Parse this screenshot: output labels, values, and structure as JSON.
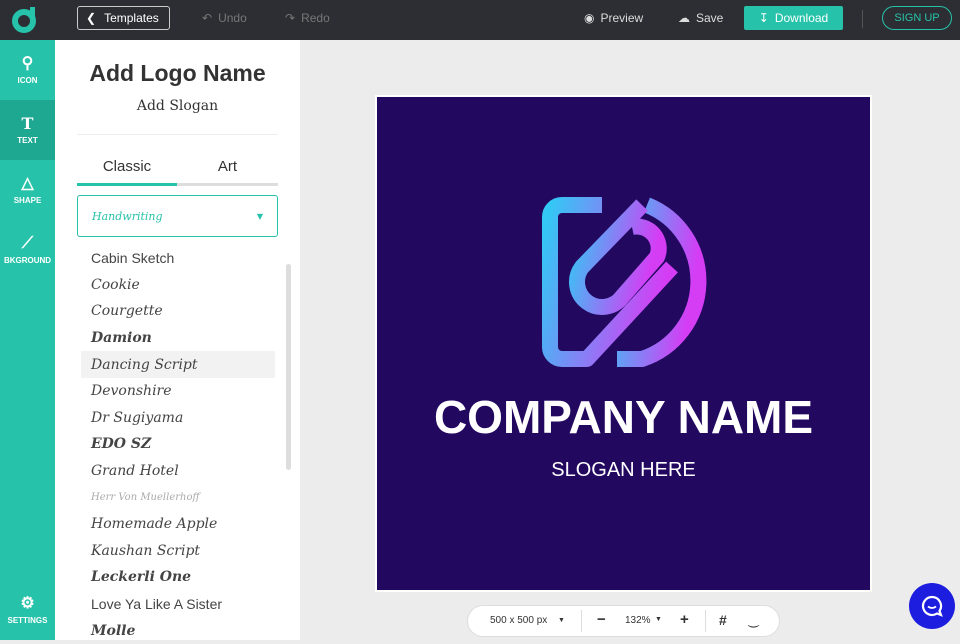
{
  "topbar": {
    "templates": "Templates",
    "undo": "Undo",
    "redo": "Redo",
    "preview": "Preview",
    "save": "Save",
    "download": "Download",
    "signup": "SIGN UP"
  },
  "rail": {
    "icon": "ICON",
    "text": "TEXT",
    "shape": "SHAPE",
    "background": "BKGROUND",
    "settings": "SETTINGS"
  },
  "panel": {
    "title": "Add Logo Name",
    "slogan": "Add Slogan",
    "tabs": [
      "Classic",
      "Art"
    ],
    "category": "Handwriting",
    "fonts": [
      "Cabin Sketch",
      "Cookie",
      "Courgette",
      "Damion",
      "Dancing Script",
      "Devonshire",
      "Dr Sugiyama",
      "EDO SZ",
      "Grand Hotel",
      "Herr Von Muellerhoff",
      "Homemade Apple",
      "Kaushan Script",
      "Leckerli One",
      "Love Ya Like A Sister",
      "Molle"
    ]
  },
  "canvas": {
    "company": "COMPANY NAME",
    "slogan": "SLOGAN HERE",
    "background": "#230860"
  },
  "zoombar": {
    "size": "500 x 500 px",
    "zoom": "132%"
  }
}
